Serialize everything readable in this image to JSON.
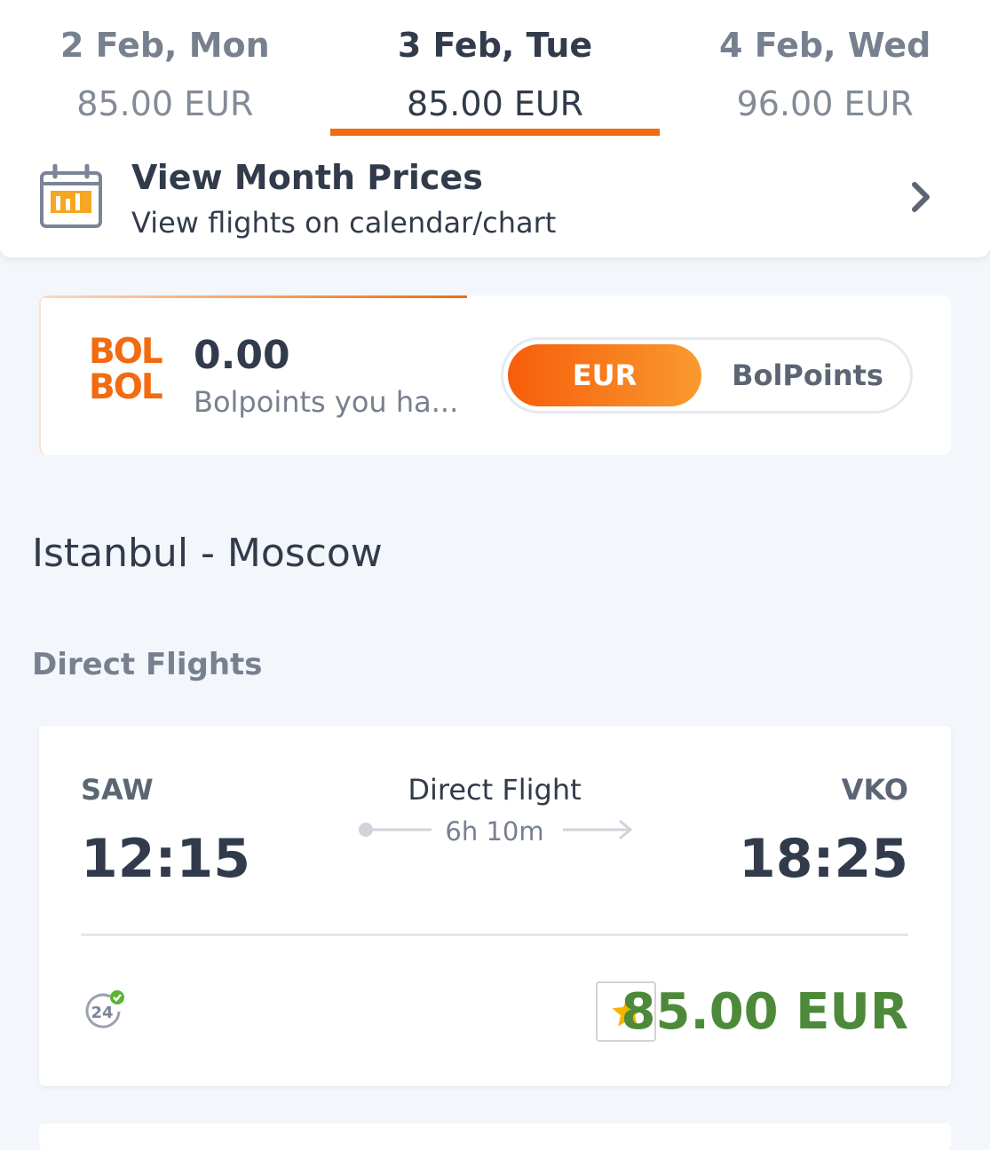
{
  "date_tabs": [
    {
      "date": "2 Feb, Mon",
      "price": "85.00 EUR"
    },
    {
      "date": "3 Feb, Tue",
      "price": "85.00 EUR"
    },
    {
      "date": "4 Feb, Wed",
      "price": "96.00 EUR"
    }
  ],
  "month_prices": {
    "title": "View Month Prices",
    "subtitle": "View flights on calendar/chart",
    "icon": "calendar-chart-icon"
  },
  "bolbol": {
    "logo_line1": "BOL",
    "logo_line2": "BOL",
    "points_value": "0.00",
    "points_label": "Bolpoints you ha...",
    "toggle_options": [
      "EUR",
      "BolPoints"
    ],
    "selected": "EUR"
  },
  "route_title": "Istanbul - Moscow",
  "section_title": "Direct Flights",
  "flight": {
    "from_code": "SAW",
    "to_code": "VKO",
    "departure_time": "12:15",
    "arrival_time": "18:25",
    "type": "Direct Flight",
    "duration": "6h 10m",
    "guarantee_label": "24",
    "price": "85.00 EUR"
  },
  "colors": {
    "accent": "#f26b10",
    "text": "#323b4b",
    "muted": "#77808f",
    "price_green": "#4c8a3a",
    "star": "#f5b400",
    "background": "#f3f6fa"
  }
}
